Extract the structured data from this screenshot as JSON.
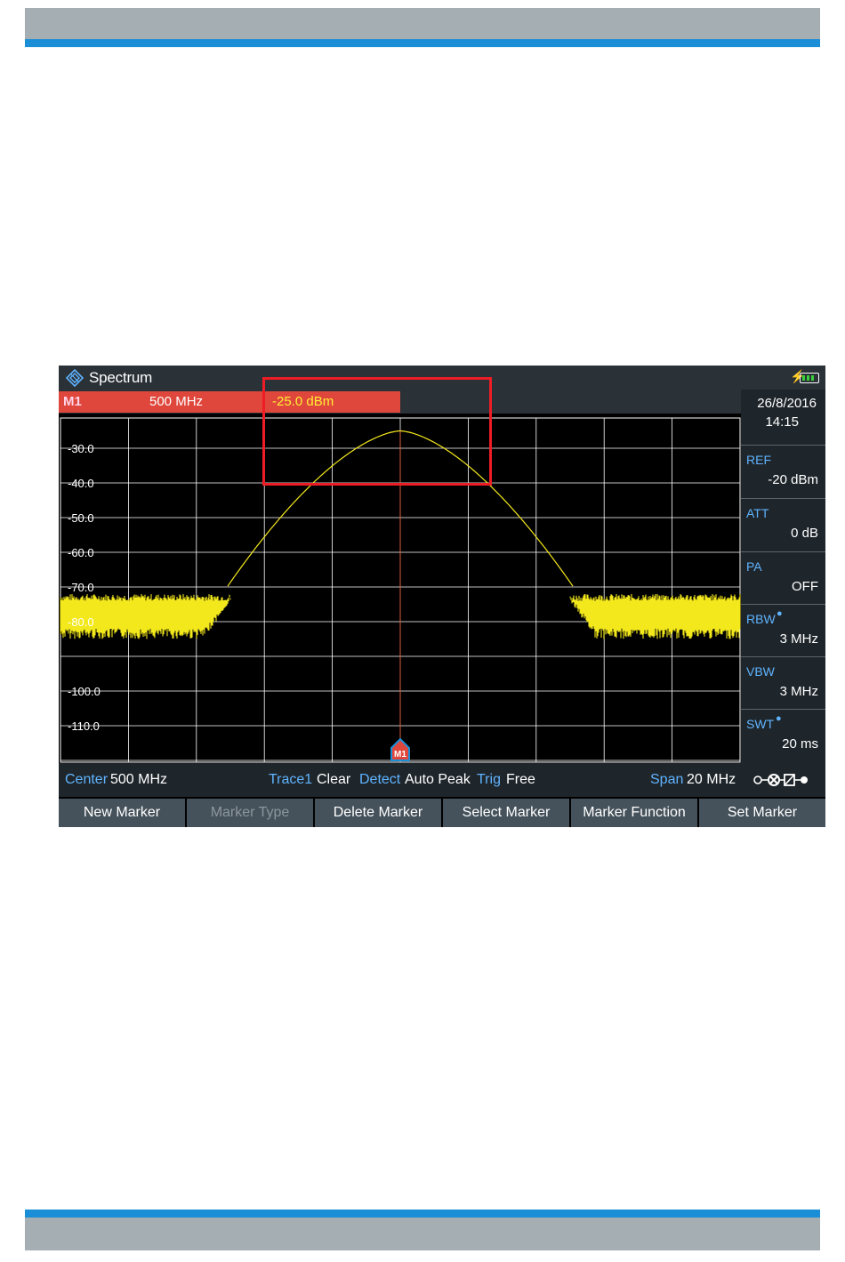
{
  "window": {
    "title": "Spectrum",
    "status_icons": [
      "power-icon",
      "battery-icon"
    ]
  },
  "marker_bar": {
    "name": "M1",
    "frequency": "500 MHz",
    "level": "-25.0 dBm"
  },
  "side_panel": {
    "date": "26/8/2016",
    "time": "14:15",
    "items": [
      {
        "label": "REF",
        "value": "-20 dBm",
        "dot": false
      },
      {
        "label": "ATT",
        "value": "0 dB",
        "dot": false
      },
      {
        "label": "PA",
        "value": "OFF",
        "dot": false
      },
      {
        "label": "RBW",
        "value": "3 MHz",
        "dot": true
      },
      {
        "label": "VBW",
        "value": "3 MHz",
        "dot": false
      },
      {
        "label": "SWT",
        "value": "20 ms",
        "dot": true
      }
    ]
  },
  "plot": {
    "y_ticks": [
      "-30.0",
      "-40.0",
      "-50.0",
      "-60.0",
      "-70.0",
      "-80.0",
      "-100.0",
      "-110.0"
    ],
    "marker_label": "M1",
    "colors": {
      "trace": "#f3e81c",
      "grid": "#ffffff",
      "marker_line": "#d9603c",
      "marker_flag": "#e0473c",
      "marker_flag_border": "#1a8fd8"
    }
  },
  "chart_data": {
    "type": "line",
    "ylim": [
      -120,
      -20
    ],
    "y_tick_values": [
      -30,
      -40,
      -50,
      -60,
      -70,
      -80,
      -100,
      -110
    ],
    "center_frequency_mhz": 500,
    "span_mhz": 20,
    "noise_floor_dbm": -75,
    "peak_dbm": -25,
    "marker": {
      "name": "M1",
      "frequency_mhz": 500,
      "level_dbm": -25
    },
    "grid": true
  },
  "status_bar": {
    "center_label": "Center",
    "center_value": "500 MHz",
    "trace_label": "Trace1",
    "trace_value": "Clear",
    "detect_label": "Detect",
    "detect_value": "Auto Peak",
    "trig_label": "Trig",
    "trig_value": "Free",
    "span_label": "Span",
    "span_value": "20 MHz"
  },
  "softkeys": [
    {
      "label": "New Marker",
      "enabled": true
    },
    {
      "label": "Marker Type",
      "enabled": false
    },
    {
      "label": "Delete Marker",
      "enabled": true
    },
    {
      "label": "Select Marker",
      "enabled": true
    },
    {
      "label": "Marker Function",
      "enabled": true
    },
    {
      "label": "Set Marker",
      "enabled": true
    }
  ]
}
